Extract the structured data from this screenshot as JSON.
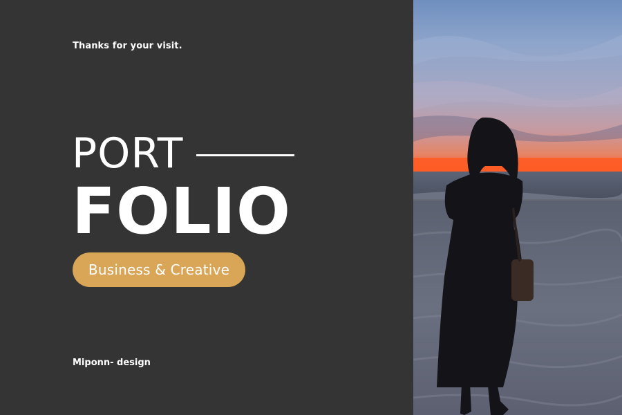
{
  "header": {
    "tagline": "Thanks for your visit."
  },
  "title": {
    "line1": "PORT",
    "line2": "FOLIO"
  },
  "badge": {
    "label": "Business & Creative"
  },
  "footer": {
    "brand": "Miponn- design"
  },
  "colors": {
    "background": "#343434",
    "accent": "#d9a556",
    "text": "#ffffff"
  },
  "photo": {
    "subject": "woman-silhouette-on-beach-at-sunset"
  }
}
